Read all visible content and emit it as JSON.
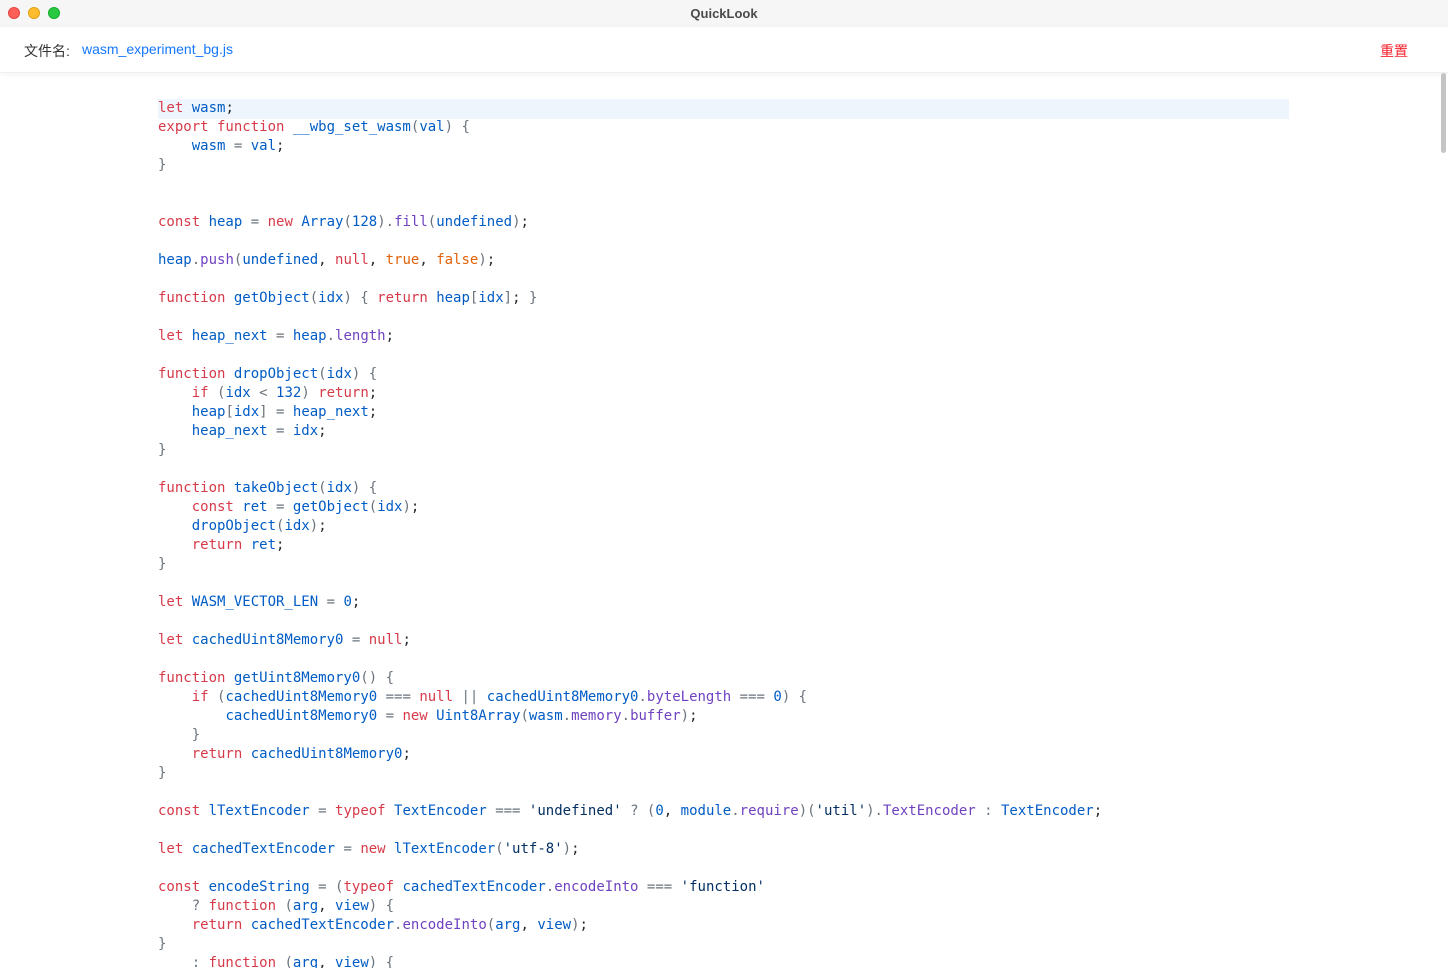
{
  "window": {
    "title": "QuickLook"
  },
  "header": {
    "filename_label": "文件名:",
    "filename": "wasm_experiment_bg.js",
    "reset_label": "重置"
  },
  "colors": {
    "kw": "#d73a49",
    "id": "#005cc5",
    "fn": "#6f42c1",
    "num": "#005cc5",
    "lit": "#e36209",
    "str": "#032f62",
    "punc": "#6a737d",
    "text": "#24292e"
  },
  "code_lines": [
    [
      [
        "kw",
        "let "
      ],
      [
        "id",
        "wasm"
      ],
      [
        "text",
        ";"
      ]
    ],
    [
      [
        "kw",
        "export function "
      ],
      [
        "id",
        "__wbg_set_wasm"
      ],
      [
        "punc",
        "("
      ],
      [
        "id",
        "val"
      ],
      [
        "punc",
        ") {"
      ]
    ],
    [
      [
        "text",
        "    "
      ],
      [
        "id",
        "wasm"
      ],
      [
        "punc",
        " = "
      ],
      [
        "id",
        "val"
      ],
      [
        "text",
        ";"
      ]
    ],
    [
      [
        "punc",
        "}"
      ]
    ],
    [],
    [],
    [
      [
        "kw",
        "const "
      ],
      [
        "id",
        "heap"
      ],
      [
        "punc",
        " = "
      ],
      [
        "kw",
        "new "
      ],
      [
        "id",
        "Array"
      ],
      [
        "punc",
        "("
      ],
      [
        "num",
        "128"
      ],
      [
        "punc",
        ")."
      ],
      [
        "fn",
        "fill"
      ],
      [
        "punc",
        "("
      ],
      [
        "id",
        "undefined"
      ],
      [
        "punc",
        ")"
      ],
      [
        "text",
        ";"
      ]
    ],
    [],
    [
      [
        "id",
        "heap"
      ],
      [
        "punc",
        "."
      ],
      [
        "fn",
        "push"
      ],
      [
        "punc",
        "("
      ],
      [
        "id",
        "undefined"
      ],
      [
        "text",
        ", "
      ],
      [
        "kw",
        "null"
      ],
      [
        "text",
        ", "
      ],
      [
        "lit",
        "true"
      ],
      [
        "text",
        ", "
      ],
      [
        "lit",
        "false"
      ],
      [
        "punc",
        ")"
      ],
      [
        "text",
        ";"
      ]
    ],
    [],
    [
      [
        "kw",
        "function "
      ],
      [
        "id",
        "getObject"
      ],
      [
        "punc",
        "("
      ],
      [
        "id",
        "idx"
      ],
      [
        "punc",
        ") { "
      ],
      [
        "kw",
        "return "
      ],
      [
        "id",
        "heap"
      ],
      [
        "punc",
        "["
      ],
      [
        "id",
        "idx"
      ],
      [
        "punc",
        "]"
      ],
      [
        "text",
        "; "
      ],
      [
        "punc",
        "}"
      ]
    ],
    [],
    [
      [
        "kw",
        "let "
      ],
      [
        "id",
        "heap_next"
      ],
      [
        "punc",
        " = "
      ],
      [
        "id",
        "heap"
      ],
      [
        "punc",
        "."
      ],
      [
        "fn",
        "length"
      ],
      [
        "text",
        ";"
      ]
    ],
    [],
    [
      [
        "kw",
        "function "
      ],
      [
        "id",
        "dropObject"
      ],
      [
        "punc",
        "("
      ],
      [
        "id",
        "idx"
      ],
      [
        "punc",
        ") {"
      ]
    ],
    [
      [
        "text",
        "    "
      ],
      [
        "kw",
        "if "
      ],
      [
        "punc",
        "("
      ],
      [
        "id",
        "idx"
      ],
      [
        "punc",
        " < "
      ],
      [
        "num",
        "132"
      ],
      [
        "punc",
        ") "
      ],
      [
        "kw",
        "return"
      ],
      [
        "text",
        ";"
      ]
    ],
    [
      [
        "text",
        "    "
      ],
      [
        "id",
        "heap"
      ],
      [
        "punc",
        "["
      ],
      [
        "id",
        "idx"
      ],
      [
        "punc",
        "] = "
      ],
      [
        "id",
        "heap_next"
      ],
      [
        "text",
        ";"
      ]
    ],
    [
      [
        "text",
        "    "
      ],
      [
        "id",
        "heap_next"
      ],
      [
        "punc",
        " = "
      ],
      [
        "id",
        "idx"
      ],
      [
        "text",
        ";"
      ]
    ],
    [
      [
        "punc",
        "}"
      ]
    ],
    [],
    [
      [
        "kw",
        "function "
      ],
      [
        "id",
        "takeObject"
      ],
      [
        "punc",
        "("
      ],
      [
        "id",
        "idx"
      ],
      [
        "punc",
        ") {"
      ]
    ],
    [
      [
        "text",
        "    "
      ],
      [
        "kw",
        "const "
      ],
      [
        "id",
        "ret"
      ],
      [
        "punc",
        " = "
      ],
      [
        "id",
        "getObject"
      ],
      [
        "punc",
        "("
      ],
      [
        "id",
        "idx"
      ],
      [
        "punc",
        ")"
      ],
      [
        "text",
        ";"
      ]
    ],
    [
      [
        "text",
        "    "
      ],
      [
        "id",
        "dropObject"
      ],
      [
        "punc",
        "("
      ],
      [
        "id",
        "idx"
      ],
      [
        "punc",
        ")"
      ],
      [
        "text",
        ";"
      ]
    ],
    [
      [
        "text",
        "    "
      ],
      [
        "kw",
        "return "
      ],
      [
        "id",
        "ret"
      ],
      [
        "text",
        ";"
      ]
    ],
    [
      [
        "punc",
        "}"
      ]
    ],
    [],
    [
      [
        "kw",
        "let "
      ],
      [
        "id",
        "WASM_VECTOR_LEN"
      ],
      [
        "punc",
        " = "
      ],
      [
        "num",
        "0"
      ],
      [
        "text",
        ";"
      ]
    ],
    [],
    [
      [
        "kw",
        "let "
      ],
      [
        "id",
        "cachedUint8Memory0"
      ],
      [
        "punc",
        " = "
      ],
      [
        "kw",
        "null"
      ],
      [
        "text",
        ";"
      ]
    ],
    [],
    [
      [
        "kw",
        "function "
      ],
      [
        "id",
        "getUint8Memory0"
      ],
      [
        "punc",
        "() {"
      ]
    ],
    [
      [
        "text",
        "    "
      ],
      [
        "kw",
        "if "
      ],
      [
        "punc",
        "("
      ],
      [
        "id",
        "cachedUint8Memory0"
      ],
      [
        "punc",
        " === "
      ],
      [
        "kw",
        "null"
      ],
      [
        "punc",
        " || "
      ],
      [
        "id",
        "cachedUint8Memory0"
      ],
      [
        "punc",
        "."
      ],
      [
        "fn",
        "byteLength"
      ],
      [
        "punc",
        " === "
      ],
      [
        "num",
        "0"
      ],
      [
        "punc",
        ") {"
      ]
    ],
    [
      [
        "text",
        "        "
      ],
      [
        "id",
        "cachedUint8Memory0"
      ],
      [
        "punc",
        " = "
      ],
      [
        "kw",
        "new "
      ],
      [
        "id",
        "Uint8Array"
      ],
      [
        "punc",
        "("
      ],
      [
        "id",
        "wasm"
      ],
      [
        "punc",
        "."
      ],
      [
        "fn",
        "memory"
      ],
      [
        "punc",
        "."
      ],
      [
        "fn",
        "buffer"
      ],
      [
        "punc",
        ")"
      ],
      [
        "text",
        ";"
      ]
    ],
    [
      [
        "text",
        "    "
      ],
      [
        "punc",
        "}"
      ]
    ],
    [
      [
        "text",
        "    "
      ],
      [
        "kw",
        "return "
      ],
      [
        "id",
        "cachedUint8Memory0"
      ],
      [
        "text",
        ";"
      ]
    ],
    [
      [
        "punc",
        "}"
      ]
    ],
    [],
    [
      [
        "kw",
        "const "
      ],
      [
        "id",
        "lTextEncoder"
      ],
      [
        "punc",
        " = "
      ],
      [
        "kw",
        "typeof "
      ],
      [
        "id",
        "TextEncoder"
      ],
      [
        "punc",
        " === "
      ],
      [
        "str",
        "'undefined'"
      ],
      [
        "punc",
        " ? ("
      ],
      [
        "num",
        "0"
      ],
      [
        "text",
        ", "
      ],
      [
        "id",
        "module"
      ],
      [
        "punc",
        "."
      ],
      [
        "fn",
        "require"
      ],
      [
        "punc",
        ")("
      ],
      [
        "str",
        "'util'"
      ],
      [
        "punc",
        ")."
      ],
      [
        "fn",
        "TextEncoder"
      ],
      [
        "punc",
        " : "
      ],
      [
        "id",
        "TextEncoder"
      ],
      [
        "text",
        ";"
      ]
    ],
    [],
    [
      [
        "kw",
        "let "
      ],
      [
        "id",
        "cachedTextEncoder"
      ],
      [
        "punc",
        " = "
      ],
      [
        "kw",
        "new "
      ],
      [
        "id",
        "lTextEncoder"
      ],
      [
        "punc",
        "("
      ],
      [
        "str",
        "'utf-8'"
      ],
      [
        "punc",
        ")"
      ],
      [
        "text",
        ";"
      ]
    ],
    [],
    [
      [
        "kw",
        "const "
      ],
      [
        "id",
        "encodeString"
      ],
      [
        "punc",
        " = ("
      ],
      [
        "kw",
        "typeof "
      ],
      [
        "id",
        "cachedTextEncoder"
      ],
      [
        "punc",
        "."
      ],
      [
        "fn",
        "encodeInto"
      ],
      [
        "punc",
        " === "
      ],
      [
        "str",
        "'function'"
      ]
    ],
    [
      [
        "text",
        "    "
      ],
      [
        "punc",
        "? "
      ],
      [
        "kw",
        "function "
      ],
      [
        "punc",
        "("
      ],
      [
        "id",
        "arg"
      ],
      [
        "text",
        ", "
      ],
      [
        "id",
        "view"
      ],
      [
        "punc",
        ") {"
      ]
    ],
    [
      [
        "text",
        "    "
      ],
      [
        "kw",
        "return "
      ],
      [
        "id",
        "cachedTextEncoder"
      ],
      [
        "punc",
        "."
      ],
      [
        "fn",
        "encodeInto"
      ],
      [
        "punc",
        "("
      ],
      [
        "id",
        "arg"
      ],
      [
        "text",
        ", "
      ],
      [
        "id",
        "view"
      ],
      [
        "punc",
        ")"
      ],
      [
        "text",
        ";"
      ]
    ],
    [
      [
        "punc",
        "}"
      ]
    ],
    [
      [
        "text",
        "    "
      ],
      [
        "punc",
        ": "
      ],
      [
        "kw",
        "function "
      ],
      [
        "punc",
        "("
      ],
      [
        "id",
        "arg"
      ],
      [
        "text",
        ", "
      ],
      [
        "id",
        "view"
      ],
      [
        "punc",
        ") {"
      ]
    ]
  ]
}
